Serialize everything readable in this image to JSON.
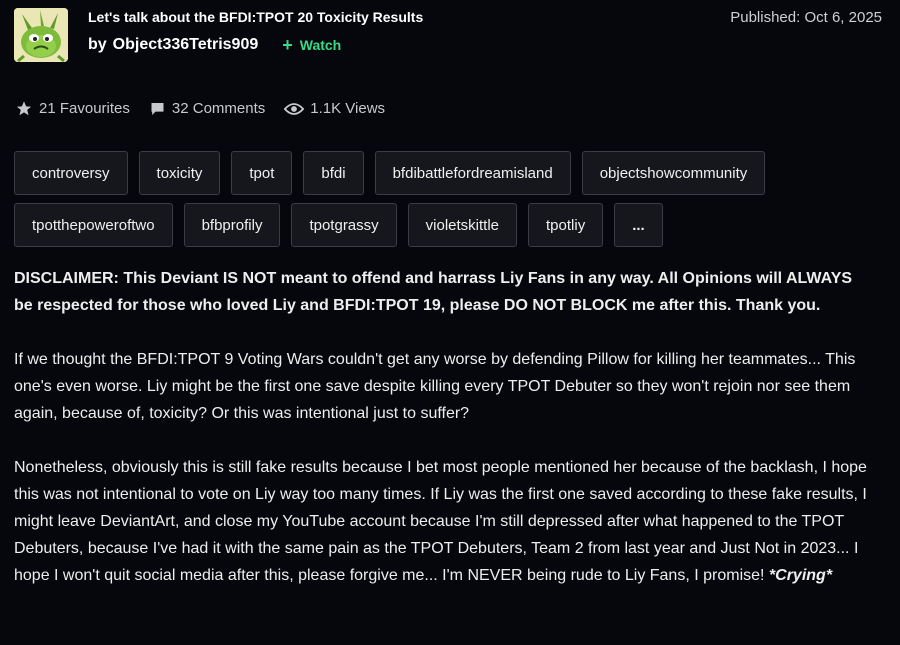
{
  "header": {
    "title": "Let's talk about the BFDI:TPOT 20 Toxicity Results",
    "by": "by",
    "author": "Object336Tetris909",
    "watch_label": "Watch",
    "published": "Published: Oct 6, 2025"
  },
  "stats": {
    "favourites": "21 Favourites",
    "comments": "32 Comments",
    "views": "1.1K Views"
  },
  "tags": [
    "controversy",
    "toxicity",
    "tpot",
    "bfdi",
    "bfdibattlefordreamisland",
    "objectshowcommunity",
    "tpotthepoweroftwo",
    "bfbprofily",
    "tpotgrassy",
    "violetskittle",
    "tpotliy",
    "..."
  ],
  "body": {
    "disclaimer": "DISCLAIMER: This Deviant IS NOT meant to offend and harrass Liy Fans in any way. All Opinions will ALWAYS be respected for those who loved Liy and BFDI:TPOT 19, please DO NOT BLOCK me after this. Thank you.",
    "paragraph1": "If we thought the BFDI:TPOT 9 Voting Wars couldn't get any worse by defending Pillow for killing her teammates... This one's even worse. Liy might be the first one save despite killing every TPOT Debuter so they won't rejoin nor see them again, because of, toxicity? Or this was intentional just to suffer?",
    "paragraph2": "Nonetheless, obviously this is still fake results because I bet most people mentioned her because of the backlash, I hope this was not intentional to vote on Liy way too many times. If Liy was the first one saved according to these fake results, I might leave DeviantArt, and close my YouTube account because I'm still depressed after what happened to the TPOT Debuters, because I've had it with the same pain as the TPOT Debuters, Team 2 from last year and Just Not in 2023... I hope I won't quit social media after this, please forgive me... I'm NEVER being rude to Liy Fans, I promise!",
    "crying": "*Crying*"
  },
  "colors": {
    "background": "#06070d",
    "watch_accent": "#39d98a",
    "tag_border": "#3a3d46"
  }
}
